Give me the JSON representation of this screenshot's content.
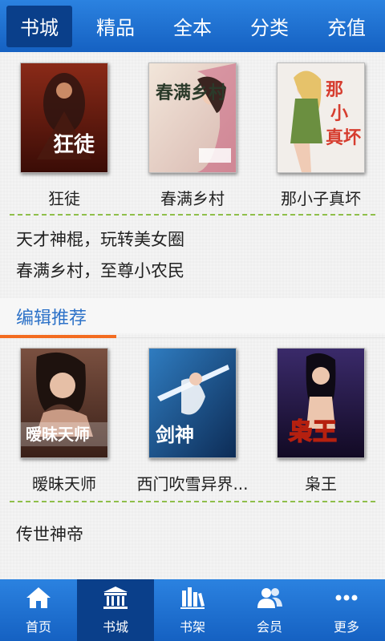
{
  "topnav": {
    "tabs": [
      {
        "label": "书城"
      },
      {
        "label": "精品"
      },
      {
        "label": "全本"
      },
      {
        "label": "分类"
      },
      {
        "label": "充值"
      }
    ]
  },
  "hot_books": [
    {
      "title": "狂徒",
      "cover_text": "狂徒",
      "colors": {
        "bg": "#6b1d12",
        "accent": "#c0301c"
      }
    },
    {
      "title": "春满乡村",
      "cover_text": "春满乡村",
      "colors": {
        "bg": "#e8d6c8",
        "accent": "#c8567a"
      }
    },
    {
      "title": "那小子真坏",
      "cover_text": "那小子真坏",
      "colors": {
        "bg": "#f0ece8",
        "accent": "#d63d2f"
      }
    }
  ],
  "recommend_links": [
    "天才神棍，玩转美女圈",
    "春满乡村，至尊小农民"
  ],
  "editor_section": {
    "title": "编辑推荐"
  },
  "editor_books": [
    {
      "title": "暧昧天师",
      "cover_text": "暧昧天师",
      "colors": {
        "bg": "#5a3a30",
        "accent": "#e8d0c0"
      }
    },
    {
      "title": "西门吹雪异界...",
      "cover_text": "剑神",
      "colors": {
        "bg": "#1d5f9a",
        "accent": "#e9f3ff"
      }
    },
    {
      "title": "枭王",
      "cover_text": "枭王",
      "colors": {
        "bg": "#2a1b4a",
        "accent": "#f2c21c"
      }
    }
  ],
  "more_links": [
    "传世神帝"
  ],
  "bottomnav": {
    "items": [
      {
        "label": "首页",
        "icon": "home-icon"
      },
      {
        "label": "书城",
        "icon": "bookstore-icon"
      },
      {
        "label": "书架",
        "icon": "bookshelf-icon"
      },
      {
        "label": "会员",
        "icon": "members-icon"
      },
      {
        "label": "更多",
        "icon": "more-icon"
      }
    ]
  }
}
